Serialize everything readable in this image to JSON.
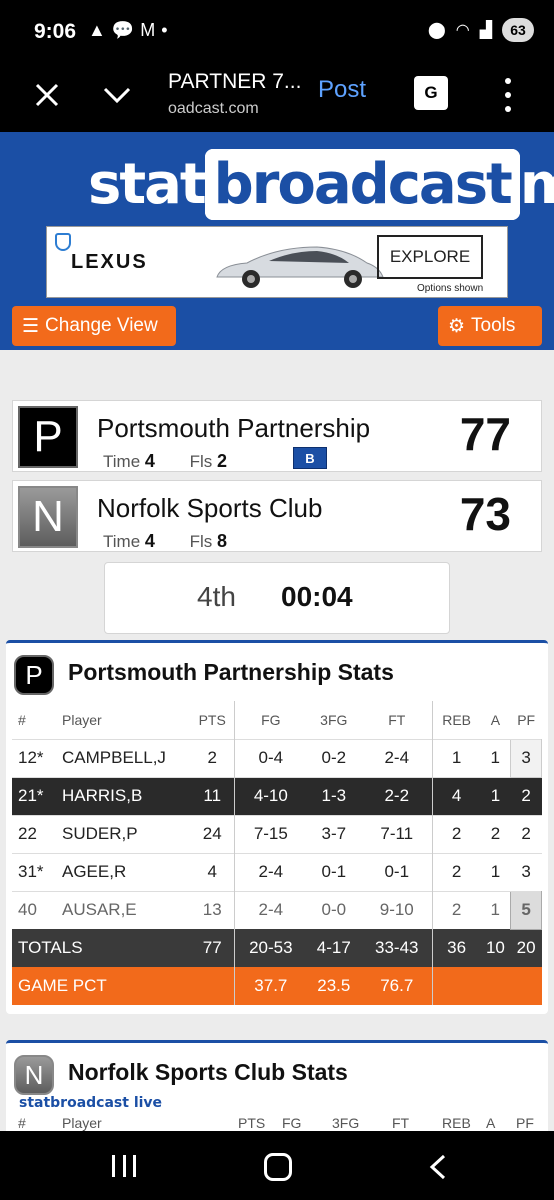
{
  "status_bar": {
    "time": "9:06",
    "battery": "63",
    "notif_icons": [
      "warning-icon",
      "chat-icon",
      "gmail-icon",
      "dot-icon"
    ],
    "right_icons": [
      "location-icon",
      "wifi-icon",
      "signal-icon"
    ]
  },
  "browser": {
    "title": "PARTNER 7...",
    "url": "oadcast.com",
    "post_label": "Post",
    "translate_label": "G"
  },
  "site": {
    "logo_prefix": "stat",
    "logo_boxed": "broadcast",
    "logo_suffix": "mob",
    "ad": {
      "brand": "LEXUS",
      "cta": "EXPLORE",
      "note": "Options shown"
    },
    "change_view_label": "Change View",
    "tools_label": "Tools"
  },
  "home": {
    "initial": "P",
    "name": "Portsmouth Partnership",
    "time_label": "Time",
    "time_value": "4",
    "fls_label": "Fls",
    "fls_value": "2",
    "bonus": "B",
    "score": "77"
  },
  "away": {
    "initial": "N",
    "name": "Norfolk Sports Club",
    "time_label": "Time",
    "time_value": "4",
    "fls_label": "Fls",
    "fls_value": "8",
    "score": "73"
  },
  "clock": {
    "period": "4th",
    "time": "00:04"
  },
  "home_stats": {
    "initial": "P",
    "title": "Portsmouth Partnership Stats",
    "headers": [
      "#",
      "Player",
      "PTS",
      "FG",
      "3FG",
      "FT",
      "REB",
      "A",
      "PF"
    ],
    "players": [
      {
        "num": "12*",
        "name": "CAMPBELL,J",
        "pts": "2",
        "fg": "0-4",
        "tfg": "0-2",
        "ft": "2-4",
        "reb": "1",
        "a": "1",
        "pf": "3"
      },
      {
        "num": "21*",
        "name": "HARRIS,B",
        "pts": "11",
        "fg": "4-10",
        "tfg": "1-3",
        "ft": "2-2",
        "reb": "4",
        "a": "1",
        "pf": "2"
      },
      {
        "num": "22",
        "name": "SUDER,P",
        "pts": "24",
        "fg": "7-15",
        "tfg": "3-7",
        "ft": "7-11",
        "reb": "2",
        "a": "2",
        "pf": "2"
      },
      {
        "num": "31*",
        "name": "AGEE,R",
        "pts": "4",
        "fg": "2-4",
        "tfg": "0-1",
        "ft": "0-1",
        "reb": "2",
        "a": "1",
        "pf": "3"
      },
      {
        "num": "40",
        "name": "AUSAR,E",
        "pts": "13",
        "fg": "2-4",
        "tfg": "0-0",
        "ft": "9-10",
        "reb": "2",
        "a": "1",
        "pf": "5"
      }
    ],
    "totals": {
      "label": "TOTALS",
      "pts": "77",
      "fg": "20-53",
      "tfg": "4-17",
      "ft": "33-43",
      "reb": "36",
      "a": "10",
      "pf": "20"
    },
    "pct": {
      "label": "GAME PCT",
      "fg": "37.7",
      "tfg": "23.5",
      "ft": "76.7"
    }
  },
  "away_stats": {
    "initial": "N",
    "title": "Norfolk Sports Club Stats",
    "watermark": "statbroadcast live",
    "headers": [
      "#",
      "Player",
      "PTS",
      "FG",
      "3FG",
      "FT",
      "REB",
      "A",
      "PF"
    ]
  }
}
